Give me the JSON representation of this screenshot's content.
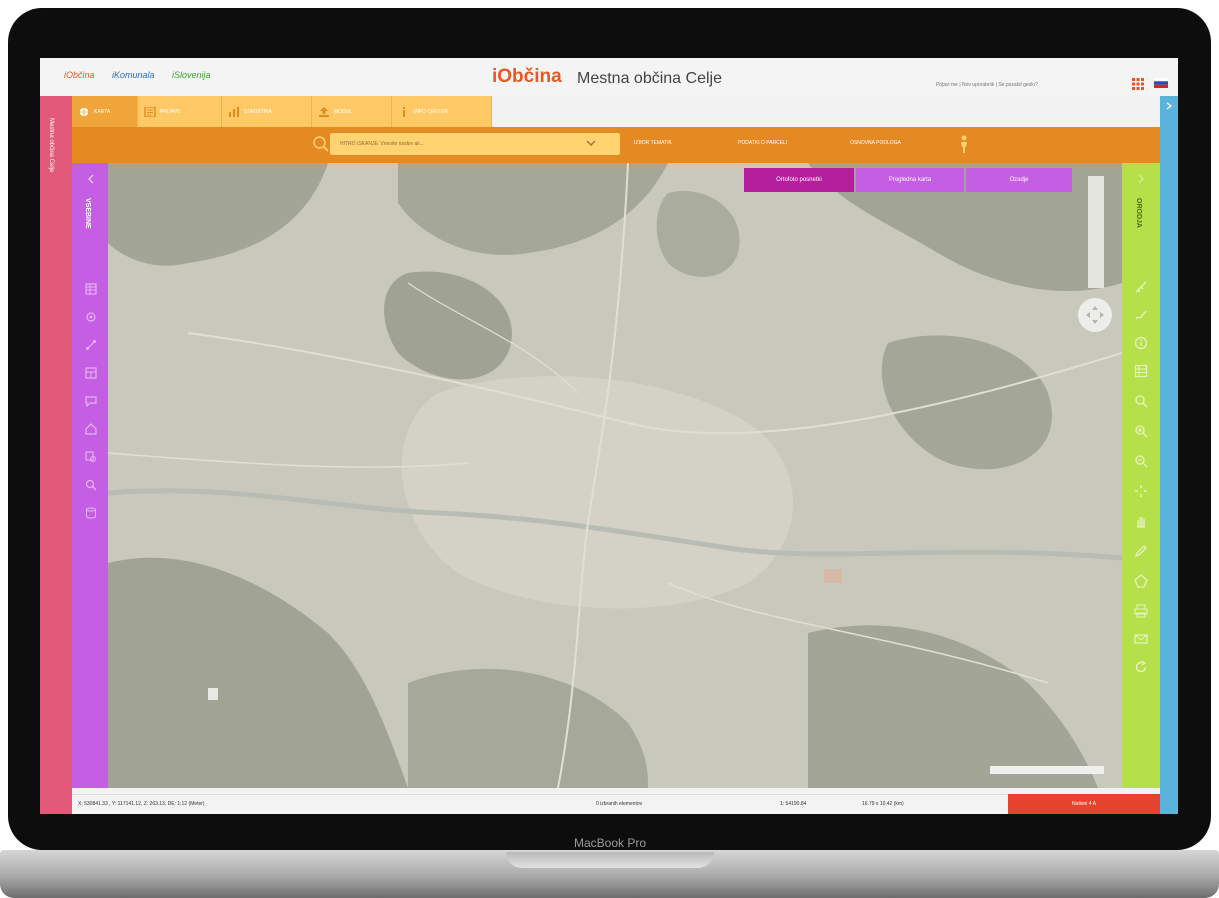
{
  "device": {
    "brand_label": "MacBook Pro"
  },
  "header": {
    "links": [
      {
        "label": "iObčina",
        "color": "#e25b23"
      },
      {
        "label": "iKomunala",
        "color": "#2b6fb6"
      },
      {
        "label": "iSlovenija",
        "color": "#41a12f"
      }
    ],
    "logo": "iObčina",
    "title": "Mestna občina Celje",
    "user_links": "Prijavi me | Nov uporabnik | Se pozabil geslo?",
    "icons": [
      "apps-grid-icon",
      "slovenian-flag-icon"
    ]
  },
  "left_strip": {
    "label": "Mestna občina Celje"
  },
  "tabs": [
    {
      "label": "KARTA",
      "icon": "globe-icon",
      "active": true
    },
    {
      "label": "PRIJAVE",
      "icon": "form-icon"
    },
    {
      "label": "STATISTIKA",
      "icon": "bar-chart-icon"
    },
    {
      "label": "MODUL",
      "icon": "upload-icon"
    },
    {
      "label": "INFO CENTER",
      "icon": "info-icon"
    }
  ],
  "toolbar": {
    "search_placeholder": "HITRO ISKANJE: Vnesite naslov ali...",
    "menus": [
      "IZBOR TEMATIK",
      "PODATKI O PARCELI",
      "OSNOVNA PODLOGA"
    ],
    "icons": [
      "search-icon",
      "chevron-down-icon",
      "help-icon",
      "person-icon"
    ]
  },
  "left_panel": {
    "title": "VSEBINE",
    "icons": [
      "layers-icon",
      "settings-icon",
      "share-icon",
      "table-icon",
      "comment-icon",
      "home-icon",
      "map-search-icon",
      "search-icon",
      "database-icon"
    ]
  },
  "right_panel": {
    "title": "ORODJA",
    "icons": [
      "measure-icon",
      "draw-icon",
      "info-circle-icon",
      "table-icon",
      "search-icon",
      "zoom-in-icon",
      "zoom-out-icon",
      "full-extent-icon",
      "pan-hand-icon",
      "pencil-icon",
      "polygon-icon",
      "print-icon",
      "email-icon",
      "refresh-icon"
    ]
  },
  "map_buttons": [
    {
      "label": "Ortofoto posnetki",
      "color": "#b51f9d"
    },
    {
      "label": "Pregledna karta",
      "color": "#c45ee2"
    },
    {
      "label": "Ozadje",
      "color": "#c45ee2"
    }
  ],
  "status": {
    "coords": "X: 530841.33 , Y: 117141.12, Z: 263.13, DE: 1:12 (Meter)",
    "selected": "0 izbranih elementov",
    "scale": "1: 54190.84",
    "extent": "16.79 x 10.42 (km)",
    "print_label": "Natisni 4 A"
  }
}
